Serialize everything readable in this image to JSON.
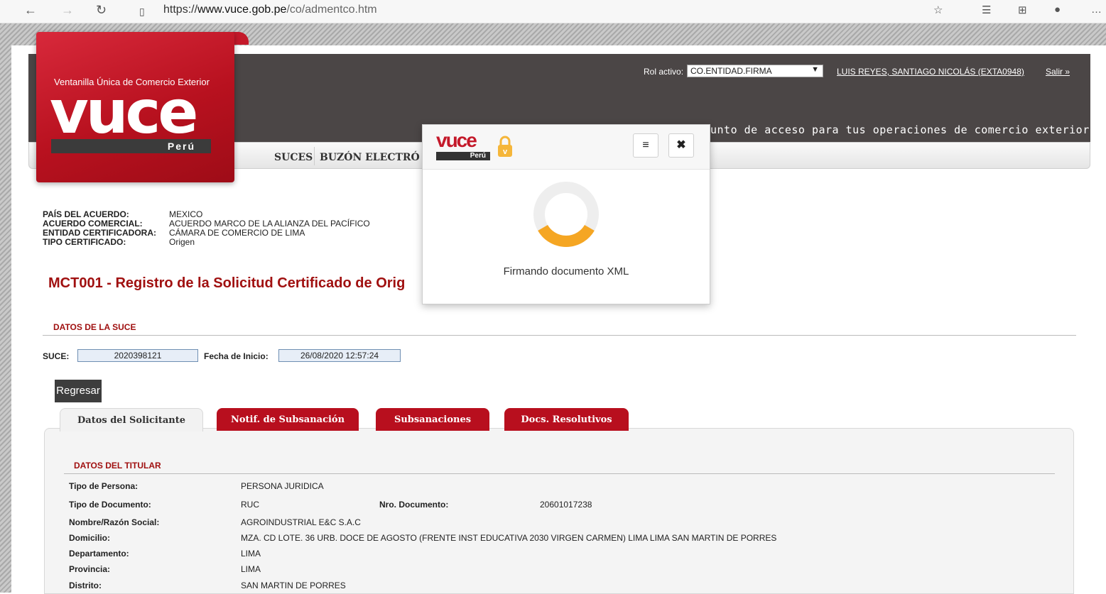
{
  "browser": {
    "url_prefix": "https://",
    "url_host": "www.vuce.gob.pe",
    "url_path": "/co/admentco.htm"
  },
  "logo": {
    "subtitle": "Ventanilla Única de Comercio Exterior",
    "word": "vuce",
    "country": "Perú"
  },
  "header": {
    "rol_label": "Rol activo:",
    "rol_value": "CO.ENTIDAD.FIRMA",
    "user": "LUIS REYES, SANTIAGO NICOLÁS (EXTA0948)",
    "salir": "Salir »",
    "tagline": "unto de acceso para tus operaciones de comercio exterior"
  },
  "nav": {
    "items": [
      "SUCES",
      "BUZÓN ELECTRÓ"
    ]
  },
  "info": [
    {
      "label": "PAÍS DEL ACUERDO:",
      "value": "MEXICO"
    },
    {
      "label": "ACUERDO COMERCIAL:",
      "value": "ACUERDO MARCO DE LA ALIANZA DEL PACÍFICO"
    },
    {
      "label": "ENTIDAD CERTIFICADORA:",
      "value": "CÁMARA DE COMERCIO DE LIMA"
    },
    {
      "label": "TIPO CERTIFICADO:",
      "value": "Origen"
    }
  ],
  "page_title": "MCT001 - Registro de la Solicitud Certificado de Orig",
  "suce_section": {
    "title": "DATOS DE LA SUCE",
    "suce_label": "SUCE:",
    "suce_value": "2020398121",
    "fecha_label": "Fecha de Inicio:",
    "fecha_value": "26/08/2020 12:57:24"
  },
  "back_button": "Regresar",
  "tabs": [
    "Datos del Solicitante",
    "Notif. de Subsanación",
    "Subsanaciones",
    "Docs. Resolutivos"
  ],
  "titular": {
    "title": "DATOS DEL TITULAR",
    "tipo_persona_label": "Tipo de Persona:",
    "tipo_persona": "PERSONA JURIDICA",
    "tipo_doc_label": "Tipo de Documento:",
    "tipo_doc": "RUC",
    "nro_doc_label": "Nro. Documento:",
    "nro_doc": "20601017238",
    "nombre_label": "Nombre/Razón Social:",
    "nombre": "AGROINDUSTRIAL E&C S.A.C",
    "domicilio_label": "Domicilio:",
    "domicilio": "MZA. CD LOTE. 36 URB. DOCE DE AGOSTO (FRENTE INST EDUCATIVA 2030 VIRGEN CARMEN) LIMA LIMA SAN MARTIN DE PORRES",
    "departamento_label": "Departamento:",
    "departamento": "LIMA",
    "provincia_label": "Provincia:",
    "provincia": "LIMA",
    "distrito_label": "Distrito:",
    "distrito": "SAN MARTIN DE PORRES"
  },
  "modal": {
    "logo_word": "vuce",
    "logo_country": "Perú",
    "menu_glyph": "≡",
    "close_glyph": "✖",
    "message": "Firmando documento XML"
  },
  "colors": {
    "brand_red": "#b80f1e",
    "header_dark": "#4b4646",
    "spinner_track": "#eeeeee",
    "spinner_accent": "#f5a623"
  }
}
